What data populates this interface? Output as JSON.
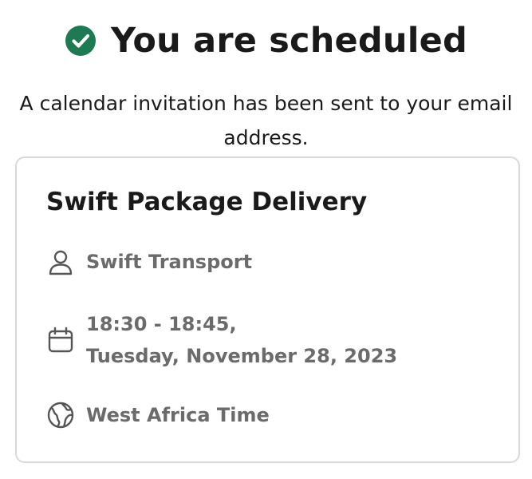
{
  "header": {
    "title": "You are scheduled",
    "status_icon": "check-circle-icon",
    "accent_color": "#1e7a52"
  },
  "subtitle": "A calendar invitation has been sent to your email address.",
  "event": {
    "name": "Swift Package Delivery",
    "organizer": "Swift Transport",
    "organizer_icon": "person-icon",
    "time_range": "18:30 - 18:45,",
    "date": "Tuesday, November 28, 2023",
    "date_icon": "calendar-icon",
    "timezone": "West Africa Time",
    "timezone_icon": "globe-icon"
  }
}
